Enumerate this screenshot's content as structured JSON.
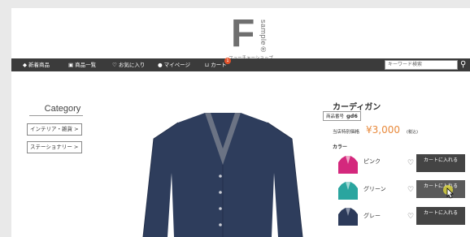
{
  "header": {
    "logo_letter": "F",
    "logo_sample": "sample®",
    "shop_name": "フューチャーショップ"
  },
  "nav": {
    "items": [
      {
        "icon": "diamond-icon",
        "label": "新着商品"
      },
      {
        "icon": "bag-icon",
        "label": "商品一覧"
      },
      {
        "icon": "heart-icon",
        "label": "お気に入り"
      },
      {
        "icon": "person-icon",
        "label": "マイページ"
      },
      {
        "icon": "cart-icon",
        "label": "カート"
      }
    ],
    "cart_count": "1",
    "search_placeholder": "キーワード検索"
  },
  "category": {
    "title": "Category",
    "items": [
      "インテリア・雑貨 >",
      "ステーショナリー >"
    ]
  },
  "product": {
    "name": "カーディガン",
    "code_label": "商品番号",
    "code": "gd6",
    "price_label": "当店特別価格",
    "price": "¥3,000",
    "tax": "(税込)",
    "color_label": "カラー",
    "colors": [
      {
        "name": "ピンク",
        "hex": "#d4287d",
        "cart_label": "カートに入れる"
      },
      {
        "name": "グリーン",
        "hex": "#2aa59f",
        "cart_label": "カートに入れる"
      },
      {
        "name": "グレー",
        "hex": "#2c3a5a",
        "cart_label": "カートに入れる"
      }
    ]
  },
  "colors": {
    "nav_bg": "#3b3b3b",
    "price": "#e8893b",
    "cardigan": "#2e3d5c"
  }
}
